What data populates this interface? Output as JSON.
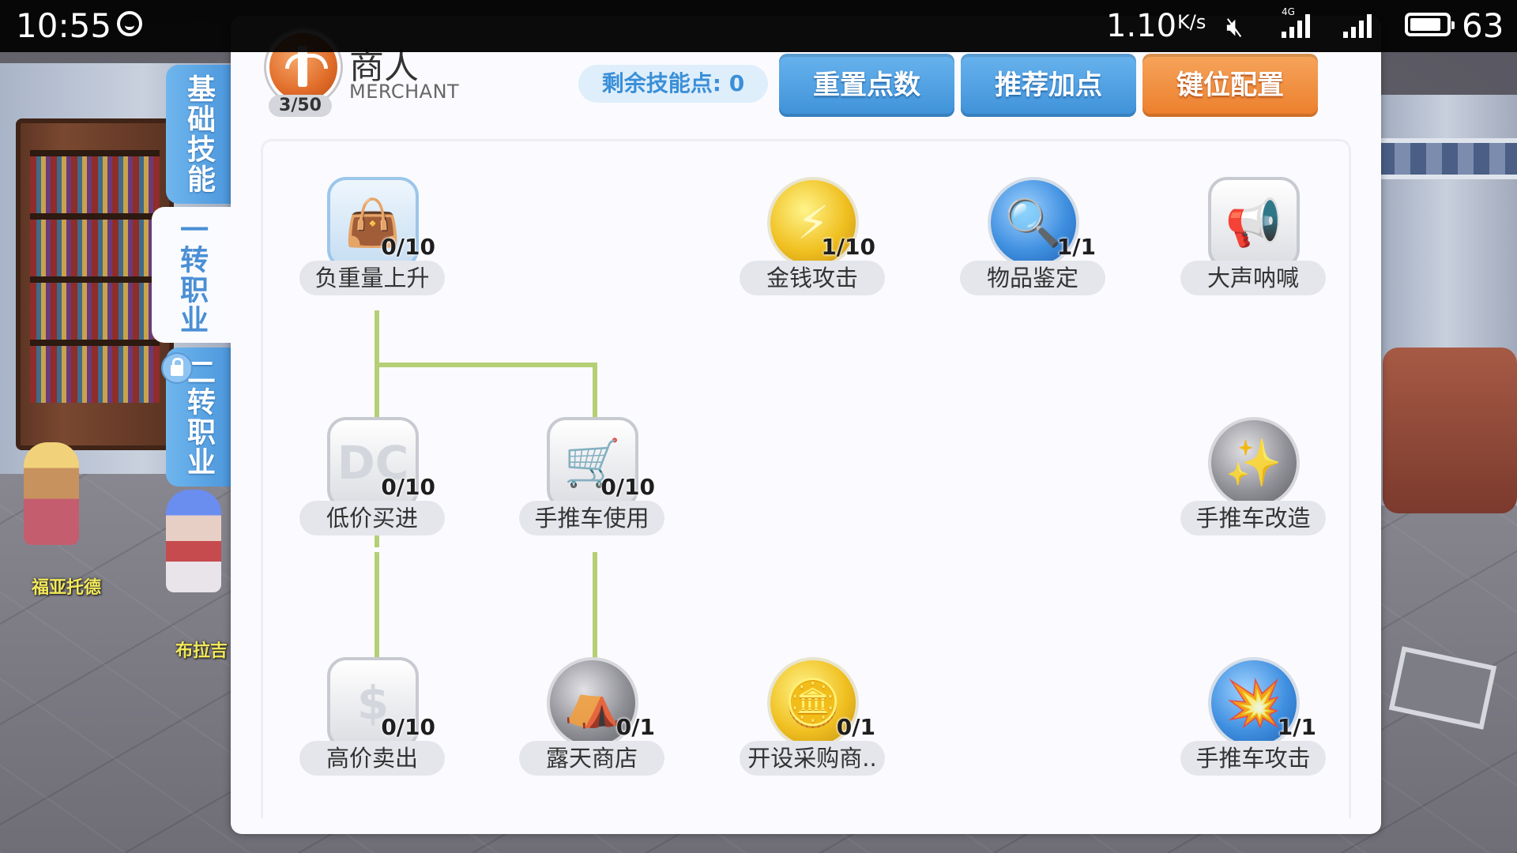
{
  "status_bar": {
    "time": "10:55",
    "network_speed": "1.10",
    "speed_unit": "K/s",
    "network_type": "4G",
    "battery": "63"
  },
  "side_tabs": [
    {
      "label": "基础技能",
      "active": false,
      "locked": false
    },
    {
      "label": "一转职业",
      "active": true,
      "locked": false
    },
    {
      "label": "二转职业",
      "active": false,
      "locked": true
    }
  ],
  "character": {
    "class_name": "商人",
    "class_name_en": "MERCHANT",
    "level": "3/50"
  },
  "toolbar": {
    "skill_points_label": "剩余技能点:",
    "skill_points_value": "0",
    "reset_label": "重置点数",
    "recommend_label": "推荐加点",
    "keybind_label": "键位配置"
  },
  "skills": [
    {
      "id": "enlarge-weight",
      "name": "负重量上升",
      "level": "0/10",
      "icon": "bag-icon",
      "glyph": "👜"
    },
    {
      "id": "mammonite",
      "name": "金钱攻击",
      "level": "1/10",
      "icon": "money-attack-icon",
      "glyph": "⚡"
    },
    {
      "id": "item-appraisal",
      "name": "物品鉴定",
      "level": "1/1",
      "icon": "magnifier-icon",
      "glyph": "🔍"
    },
    {
      "id": "loud-exclamation",
      "name": "大声呐喊",
      "level": "",
      "icon": "megaphone-icon",
      "glyph": "📢"
    },
    {
      "id": "discount",
      "name": "低价买进",
      "level": "0/10",
      "icon": "dc-icon",
      "glyph": "DC"
    },
    {
      "id": "pushcart",
      "name": "手推车使用",
      "level": "0/10",
      "icon": "cart-icon",
      "glyph": "🛒"
    },
    {
      "id": "change-cart",
      "name": "手推车改造",
      "level": "",
      "icon": "cart-sparkle-icon",
      "glyph": "✨"
    },
    {
      "id": "overcharge",
      "name": "高价卖出",
      "level": "0/10",
      "icon": "dollar-icon",
      "glyph": "$"
    },
    {
      "id": "vending",
      "name": "露天商店",
      "level": "0/1",
      "icon": "tent-icon",
      "glyph": "⛺"
    },
    {
      "id": "buying-store",
      "name": "开设采购商..",
      "level": "0/1",
      "icon": "coins-icon",
      "glyph": "🪙"
    },
    {
      "id": "cart-revolution",
      "name": "手推车攻击",
      "level": "1/1",
      "icon": "cart-attack-icon",
      "glyph": "💥"
    }
  ],
  "npcs": [
    {
      "name": "福亚托德"
    },
    {
      "name": "布拉吉"
    }
  ],
  "colors": {
    "accent_blue": "#4c97dc",
    "accent_orange": "#ec7e2c",
    "tree_line": "#b5cf74"
  }
}
